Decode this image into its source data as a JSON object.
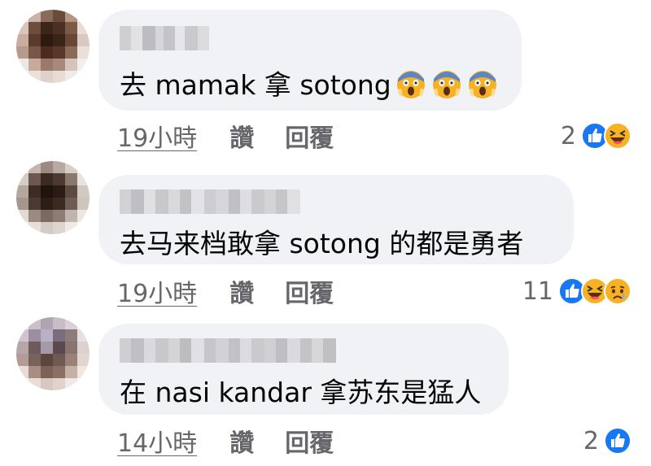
{
  "comments": [
    {
      "text": "去 mamak 拿 sotong",
      "emojis": [
        "scream-emoji",
        "scream-emoji",
        "scream-emoji"
      ],
      "time": "19小時",
      "like_label": "讚",
      "reply_label": "回覆",
      "reaction_count": "2",
      "reactions": [
        "like-icon",
        "haha-icon"
      ]
    },
    {
      "text": "去马来档敢拿 sotong 的都是勇者",
      "emojis": [],
      "time": "19小時",
      "like_label": "讚",
      "reply_label": "回覆",
      "reaction_count": "11",
      "reactions": [
        "like-icon",
        "haha-icon",
        "sad-icon"
      ]
    },
    {
      "text": "在 nasi kandar 拿苏东是猛人",
      "emojis": [],
      "time": "14小時",
      "like_label": "讚",
      "reply_label": "回覆",
      "reaction_count": "2",
      "reactions": [
        "like-icon"
      ]
    }
  ],
  "colors": {
    "bubble": "#f0f2f5",
    "meta_text": "#65676b",
    "like_blue": "#1877f2",
    "haha_yellow": "#f7b125"
  }
}
